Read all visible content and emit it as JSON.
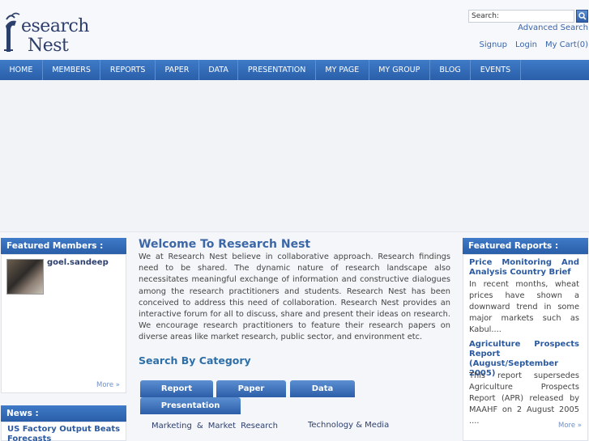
{
  "logo": {
    "line1": "esearch",
    "line2": "Nest"
  },
  "search": {
    "label": "Search:",
    "advanced": "Advanced Search"
  },
  "top_links": [
    "Signup",
    "Login",
    "My Cart(0)"
  ],
  "nav": [
    "HOME",
    "MEMBERS",
    "REPORTS",
    "PAPER",
    "DATA",
    "PRESENTATION",
    "MY PAGE",
    "MY GROUP",
    "BLOG",
    "EVENTS"
  ],
  "featured_members": {
    "title": "Featured Members :",
    "member_name": "goel.sandeep",
    "more": "More »"
  },
  "news": {
    "title": "News :",
    "item": "US Factory Output Beats Forecasts"
  },
  "welcome": {
    "title": "Welcome To Research Nest",
    "text": "We at Research Nest believe in collaborative approach. Research findings need to be shared. The dynamic nature of research landscape also necessitates meaningful exchange of information and constructive dialogues among the research practitioners and students. Research Nest has been conceived to address this need of collaboration. Research Nest provides an interactive forum for all to discuss, share and present their ideas on research. We encourage research practitioners to feature their research papers on diverse areas like market research, public sector, and environment etc."
  },
  "category": {
    "title": "Search By Category",
    "tabs": [
      "Report",
      "Paper",
      "Data",
      "Presentation"
    ],
    "sub1": "Marketing & Market Research",
    "sub2": "Technology & Media"
  },
  "featured_reports": {
    "title": "Featured Reports :",
    "r1_title": "Price Monitoring And Analysis Country Brief",
    "r1_text": "In recent months, wheat prices have shown a downward trend in some major markets such as Kabul....",
    "r2_title": "Agriculture Prospects Report (August/September 2005)",
    "r2_text": "This report supersedes Agriculture Prospects Report (APR) released by MAAHF on 2 August 2005 ....",
    "more": "More »"
  }
}
